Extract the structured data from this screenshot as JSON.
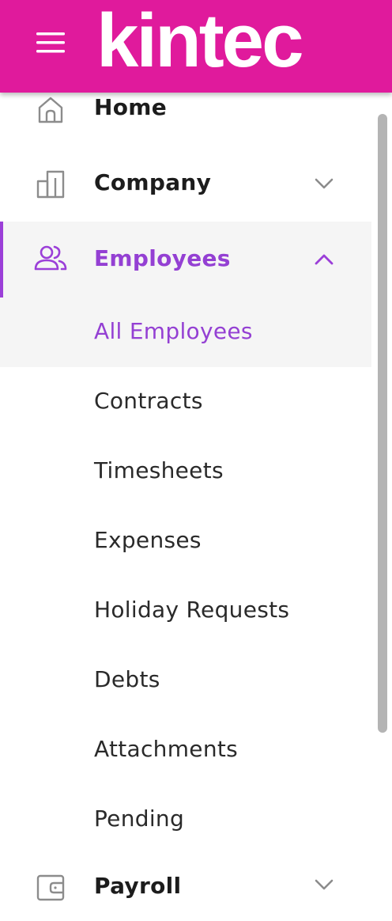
{
  "header": {
    "logo_text": "kintec",
    "background_color": "#e01a9c",
    "menu_icon": "hamburger-menu-icon"
  },
  "nav": {
    "items": [
      {
        "label": "Home",
        "icon": "home-icon"
      },
      {
        "label": "Company",
        "icon": "building-icon",
        "chevron": "chevron-down-icon"
      },
      {
        "label": "Employees",
        "icon": "people-icon",
        "chevron": "chevron-up-icon",
        "active": true
      },
      {
        "label": "Payroll",
        "icon": "wallet-icon",
        "chevron": "chevron-down-icon"
      }
    ],
    "employees_submenu": [
      {
        "label": "All Employees",
        "current": true
      },
      {
        "label": "Contracts"
      },
      {
        "label": "Timesheets"
      },
      {
        "label": "Expenses"
      },
      {
        "label": "Holiday Requests"
      },
      {
        "label": "Debts"
      },
      {
        "label": "Attachments"
      },
      {
        "label": "Pending"
      }
    ]
  },
  "colors": {
    "accent": "#9b3fd8",
    "brand": "#e01a9c",
    "active_background": "#f5f5f5"
  }
}
